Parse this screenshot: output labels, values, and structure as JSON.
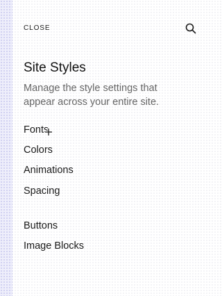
{
  "panel": {
    "close_label": "CLOSE",
    "search_icon": "search-icon",
    "title": "Site Styles",
    "description": "Manage the style settings that appear across your entire site."
  },
  "nav": {
    "items": [
      {
        "label": "Fonts"
      },
      {
        "label": "Colors"
      },
      {
        "label": "Animations"
      },
      {
        "label": "Spacing"
      },
      {
        "label": "Buttons"
      },
      {
        "label": "Image Blocks"
      }
    ]
  },
  "cursor": {
    "icon": "move-cursor-icon"
  }
}
